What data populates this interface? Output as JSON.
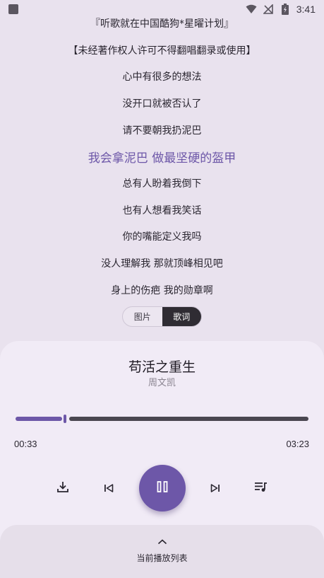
{
  "status_bar": {
    "time": "3:41",
    "icons": [
      "notification-square-icon",
      "wifi-icon",
      "no-signal-icon",
      "battery-charging-icon"
    ]
  },
  "lyrics": [
    {
      "text": "『听歌就在中国酷狗*星曜计划』",
      "active": false
    },
    {
      "text": "【未经著作权人许可不得翻唱翻录或使用】",
      "active": false
    },
    {
      "text": "心中有很多的想法",
      "active": false
    },
    {
      "text": "没开口就被否认了",
      "active": false
    },
    {
      "text": "请不要朝我扔泥巴",
      "active": false
    },
    {
      "text": "我会拿泥巴 做最坚硬的盔甲",
      "active": true
    },
    {
      "text": "总有人盼着我倒下",
      "active": false
    },
    {
      "text": "也有人想看我笑话",
      "active": false
    },
    {
      "text": "你的嘴能定义我吗",
      "active": false
    },
    {
      "text": "没人理解我 那就顶峰相见吧",
      "active": false
    },
    {
      "text": "身上的伤疤 我的勋章啊",
      "active": false
    }
  ],
  "toggle": {
    "image_label": "图片",
    "lyrics_label": "歌词",
    "selected": "歌词"
  },
  "player": {
    "title": "苟活之重生",
    "artist": "周文凯",
    "current_time": "00:33",
    "total_time": "03:23",
    "progress": 0.163,
    "accent_color": "#6d57a8",
    "controls": [
      "download-icon",
      "skip-previous-icon",
      "pause-icon",
      "skip-next-icon",
      "queue-music-icon"
    ]
  },
  "playlist_sheet": {
    "label": "当前播放列表",
    "icon": "chevron-up-icon"
  }
}
